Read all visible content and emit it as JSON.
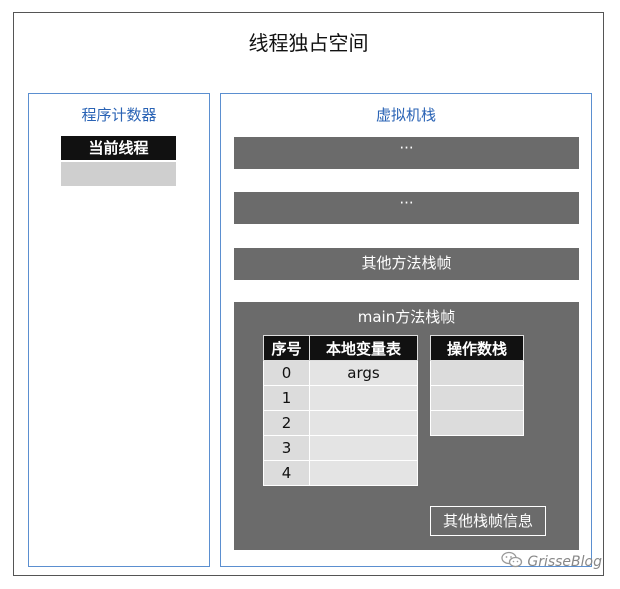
{
  "outer": {
    "title": "线程独占空间"
  },
  "pc": {
    "title": "程序计数器",
    "header": "当前线程"
  },
  "vm": {
    "title": "虚拟机栈",
    "frames": [
      "···",
      "···",
      "其他方法栈帧"
    ],
    "main": {
      "title": "main方法栈帧",
      "locals": {
        "headers": [
          "序号",
          "本地变量表"
        ],
        "rows": [
          [
            "0",
            "args"
          ],
          [
            "1",
            ""
          ],
          [
            "2",
            ""
          ],
          [
            "3",
            ""
          ],
          [
            "4",
            ""
          ]
        ]
      },
      "opstack": {
        "header": "操作数栈"
      },
      "other_info": "其他栈帧信息"
    }
  },
  "watermark": {
    "text": "GrisseBlog",
    "icon": "wechat-icon"
  },
  "colors": {
    "panel_border": "#5b8fd0",
    "title_blue": "#2a63b5",
    "frame_gray": "#6b6b6b",
    "header_black": "#111111",
    "cell_gray": "#dcdcdc"
  }
}
